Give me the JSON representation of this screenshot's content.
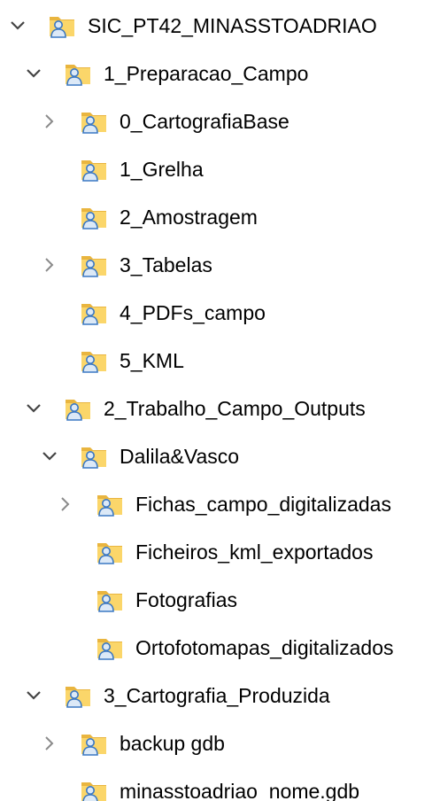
{
  "tree": {
    "items": [
      {
        "label": "SIC_PT42_MINASSTOADRIAO",
        "level": 0,
        "chevron": "expanded",
        "icon": "shared-folder-icon"
      },
      {
        "label": "1_Preparacao_Campo",
        "level": 1,
        "chevron": "expanded",
        "icon": "shared-folder-icon"
      },
      {
        "label": "0_CartografiaBase",
        "level": 2,
        "chevron": "collapsed",
        "icon": "shared-folder-icon"
      },
      {
        "label": "1_Grelha",
        "level": 2,
        "chevron": "none",
        "icon": "shared-folder-icon"
      },
      {
        "label": "2_Amostragem",
        "level": 2,
        "chevron": "none",
        "icon": "shared-folder-icon"
      },
      {
        "label": "3_Tabelas",
        "level": 2,
        "chevron": "collapsed",
        "icon": "shared-folder-icon"
      },
      {
        "label": "4_PDFs_campo",
        "level": 2,
        "chevron": "none",
        "icon": "shared-folder-icon"
      },
      {
        "label": "5_KML",
        "level": 2,
        "chevron": "none",
        "icon": "shared-folder-icon"
      },
      {
        "label": "2_Trabalho_Campo_Outputs",
        "level": 1,
        "chevron": "expanded",
        "icon": "shared-folder-icon"
      },
      {
        "label": "Dalila&Vasco",
        "level": 2,
        "chevron": "expanded",
        "icon": "shared-folder-icon"
      },
      {
        "label": "Fichas_campo_digitalizadas",
        "level": 3,
        "chevron": "collapsed",
        "icon": "shared-folder-icon"
      },
      {
        "label": "Ficheiros_kml_exportados",
        "level": 3,
        "chevron": "none",
        "icon": "shared-folder-icon"
      },
      {
        "label": "Fotografias",
        "level": 3,
        "chevron": "none",
        "icon": "shared-folder-icon"
      },
      {
        "label": "Ortofotomapas_digitalizados",
        "level": 3,
        "chevron": "none",
        "icon": "shared-folder-icon"
      },
      {
        "label": "3_Cartografia_Produzida",
        "level": 1,
        "chevron": "expanded",
        "icon": "shared-folder-icon"
      },
      {
        "label": "backup gdb",
        "level": 2,
        "chevron": "collapsed",
        "icon": "shared-folder-icon"
      },
      {
        "label": "minasstoadriao_nome.gdb",
        "level": 2,
        "chevron": "none",
        "icon": "shared-folder-icon"
      }
    ]
  },
  "colors": {
    "folder_light": "#fbd66a",
    "folder_dark": "#e9b53f",
    "user_fill": "#dce9f7",
    "user_stroke": "#3b78c3",
    "chevron": "#444444",
    "chevron_collapsed": "#8a8a8a"
  }
}
